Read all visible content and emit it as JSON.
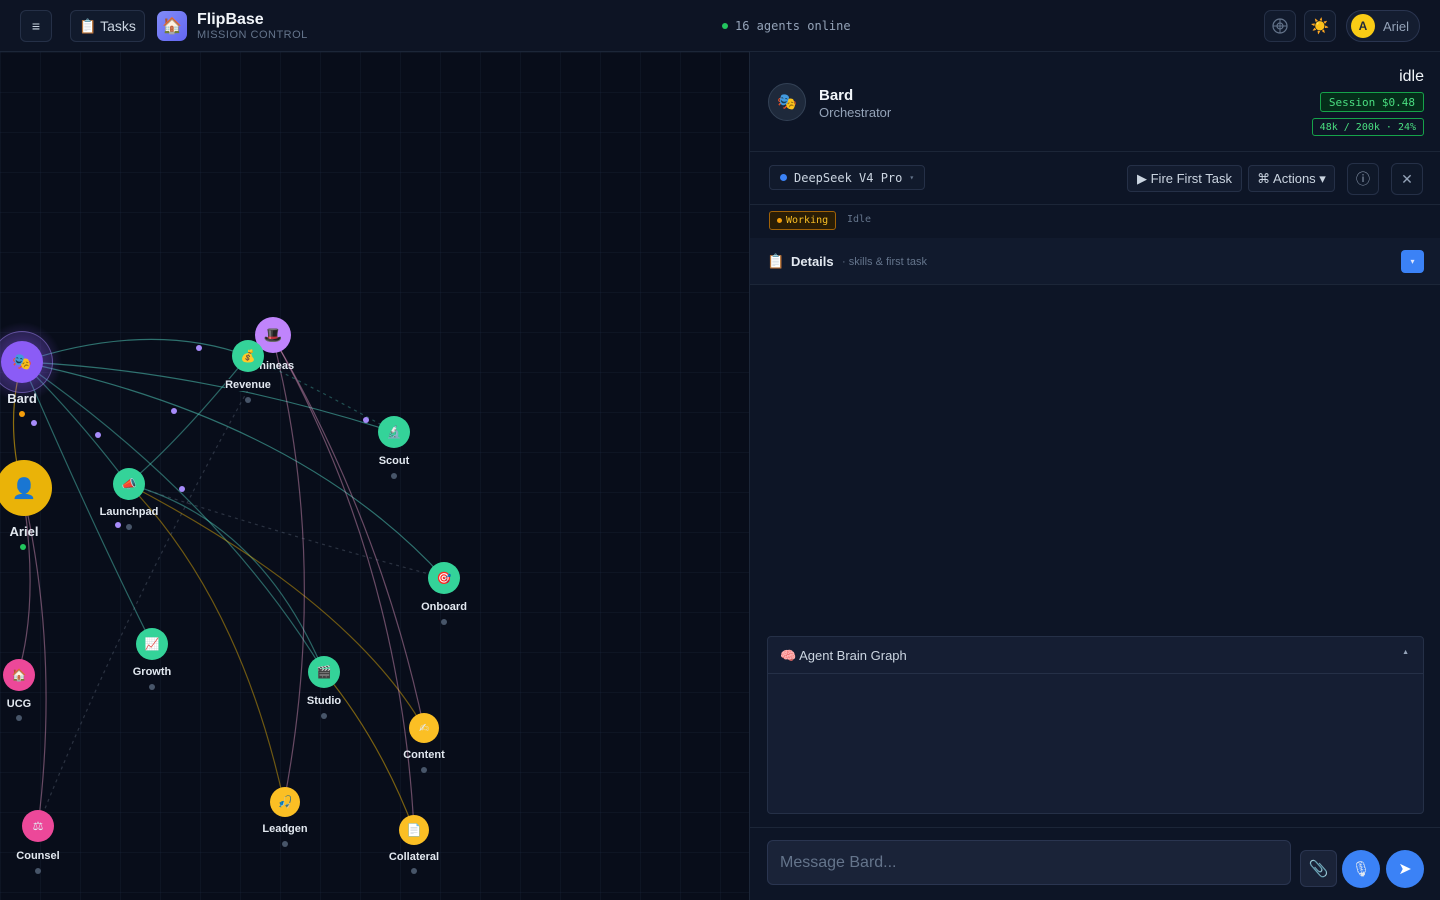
{
  "topbar": {
    "menu_icon": "hamburger-icon",
    "tasks_label": "📋 Tasks",
    "brand_name": "FlipBase",
    "brand_sub": "MISSION CONTROL",
    "logo_glyph": "🏠",
    "online_text": "16 agents online",
    "user_initial": "A",
    "user_name": "Ariel"
  },
  "graph": {
    "nodes": [
      {
        "name": "Bard",
        "glyph": "🎭"
      },
      {
        "name": "Ariel",
        "glyph": "👤"
      },
      {
        "name": "Phineas",
        "glyph": "🎩"
      },
      {
        "name": "Revenue",
        "glyph": "💰"
      },
      {
        "name": "Scout",
        "glyph": "🔬"
      },
      {
        "name": "Launchpad",
        "glyph": "📣"
      },
      {
        "name": "Onboard",
        "glyph": "🎯"
      },
      {
        "name": "Growth",
        "glyph": "📈"
      },
      {
        "name": "Studio",
        "glyph": "🎬"
      },
      {
        "name": "UCG",
        "glyph": "🏠"
      },
      {
        "name": "Content",
        "glyph": "✍"
      },
      {
        "name": "Leadgen",
        "glyph": "🎣"
      },
      {
        "name": "Collateral",
        "glyph": "📄"
      },
      {
        "name": "Counsel",
        "glyph": "⚖"
      }
    ]
  },
  "panel": {
    "agent_name": "Bard",
    "agent_role": "Orchestrator",
    "agent_glyph": "🎭",
    "status": "idle",
    "session": "Session $0.48",
    "tokens": "48k / 200k · 24%",
    "model": "DeepSeek V4 Pro",
    "fire_label": "▶ Fire First Task",
    "actions_label": "⌘ Actions ▾",
    "working_label": "Working",
    "idle_label": "Idle",
    "details_title": "Details",
    "details_sub": "· skills & first task",
    "brain_title": "🧠 Agent Brain Graph",
    "message_placeholder": "Message Bard..."
  },
  "colors": {
    "accent": "#3b82f6",
    "online": "#22c55e",
    "session_green": "#4ade80",
    "working_amber": "#fbbf24"
  }
}
